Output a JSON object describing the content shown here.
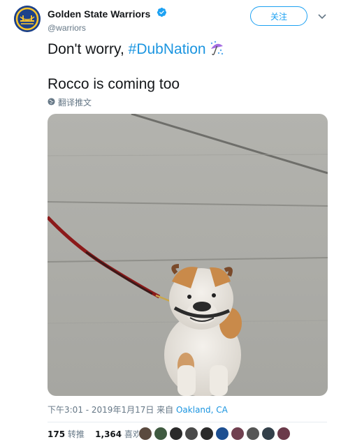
{
  "author": {
    "display_name": "Golden State Warriors",
    "handle": "@warriors",
    "verified": true,
    "avatar": "warriors-logo"
  },
  "follow_button_label": "关注",
  "tweet": {
    "line1_prefix": "Don't worry, ",
    "hashtag": "#DubNation",
    "line1_emoji": "umbrella-rain-emoji",
    "line2": "Rocco is coming too"
  },
  "translate_label": "翻译推文",
  "meta": {
    "time_date": "下午3:01 - 2019年1月17日 来自 ",
    "location": "Oakland, CA"
  },
  "stats": {
    "retweets_count": "175",
    "retweets_label": "转推",
    "likes_count": "1,364",
    "likes_label": "喜欢"
  },
  "colors": {
    "accent": "#1da1f2",
    "link": "#1b95e0",
    "muted": "#657786",
    "brand_blue": "#1d428a",
    "brand_gold": "#ffc72c"
  },
  "likers": [
    "#5a4a3f",
    "#3f5a40",
    "#2a2a2a",
    "#4a4a4a",
    "#2b2b2b",
    "#1d4f91",
    "#704050",
    "#555555",
    "#33404a",
    "#6b3a4a"
  ]
}
